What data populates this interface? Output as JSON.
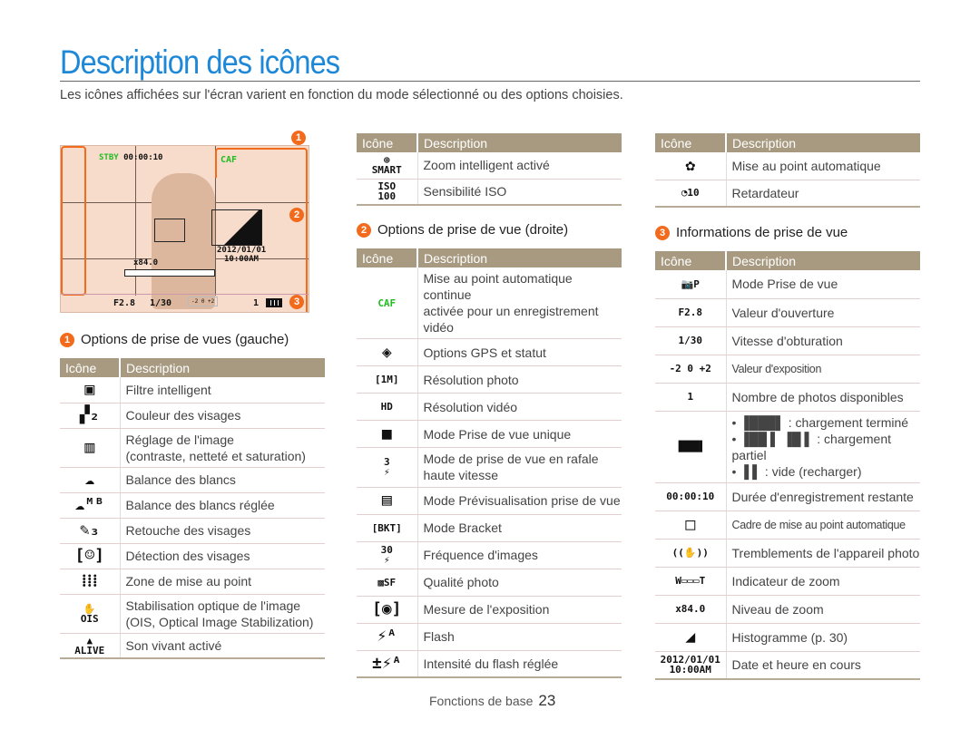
{
  "title": "Description des icônes",
  "intro": "Les icônes affichées sur l'écran varient en fonction du mode sélectionné ou des options choisies.",
  "header": {
    "icon": "Icône",
    "desc": "Description"
  },
  "colors": {
    "title": "#1e88d8",
    "table_header": "#a89a80",
    "badge": "#f26a1b",
    "caf": "#22bb22",
    "screen_bg": "#f8dccb"
  },
  "screen": {
    "stby": "STBY",
    "time": "00:00:10",
    "caf": "CAF",
    "zoom_level": "x84.0",
    "date": "2012/01/01",
    "clock": "10:00AM",
    "aperture": "F2.8",
    "shutter": "1/30",
    "shots": "1",
    "ev": "-2   0   +2",
    "badges": [
      "1",
      "2",
      "3"
    ]
  },
  "sections": [
    {
      "num": "1",
      "title": "Options de prise de vues (gauche)"
    },
    {
      "num": "2",
      "title": "Options de prise de vue (droite)"
    },
    {
      "num": "3",
      "title": "Informations de prise de vue"
    }
  ],
  "left_table": [
    {
      "icon": "smart-filter-icon",
      "glyph": "▣",
      "d": "Filtre intelligent"
    },
    {
      "icon": "face-tone-icon",
      "glyph": "▞₂",
      "d": "Couleur des visages"
    },
    {
      "icon": "image-adjust-icon",
      "glyph": "▥",
      "d": "Réglage de l'image\n(contraste, netteté et saturation)"
    },
    {
      "icon": "white-balance-icon",
      "glyph": "☁",
      "d": "Balance des blancs"
    },
    {
      "icon": "custom-white-balance-icon",
      "glyph": "☁ᴹᴮ",
      "d": "Balance des blancs réglée"
    },
    {
      "icon": "face-retouch-icon",
      "glyph": "✎₃",
      "d": "Retouche des visages"
    },
    {
      "icon": "face-detection-icon",
      "glyph": "[☺]",
      "d": "Détection des visages"
    },
    {
      "icon": "focus-area-icon",
      "glyph": "⁞⁞⁞",
      "d": "Zone de mise au point"
    },
    {
      "icon": "ois-icon",
      "glyph": "✋\nOIS",
      "d": "Stabilisation optique de l'image\n(OIS, Optical Image Stabilization)"
    },
    {
      "icon": "live-sound-icon",
      "glyph": "▲\nALIVE",
      "d": "Son vivant activé"
    }
  ],
  "mid_top_table": [
    {
      "icon": "smart-zoom-icon",
      "glyph": "⊕\nSMART",
      "d": "Zoom intelligent activé"
    },
    {
      "icon": "iso-icon",
      "glyph": "ISO\n100",
      "d": "Sensibilité ISO"
    }
  ],
  "mid_table": [
    {
      "icon": "caf-icon",
      "glyph": "CAF",
      "d": "Mise au point automatique continue\nactivée pour un enregistrement vidéo",
      "green": true
    },
    {
      "icon": "gps-icon",
      "glyph": "◈",
      "d": "Options GPS et statut"
    },
    {
      "icon": "photo-resolution-icon",
      "glyph": "[1M]",
      "d": "Résolution photo"
    },
    {
      "icon": "video-resolution-icon",
      "glyph": "HD",
      "d": "Résolution vidéo"
    },
    {
      "icon": "single-shot-icon",
      "glyph": "■",
      "d": "Mode Prise de vue unique"
    },
    {
      "icon": "burst-icon",
      "glyph": "3\n⚡",
      "d": "Mode de prise de vue en rafale\nhaute vitesse"
    },
    {
      "icon": "preview-icon",
      "glyph": "▤",
      "d": "Mode Prévisualisation prise de vue"
    },
    {
      "icon": "bracket-icon",
      "glyph": "[BKT]",
      "d": "Mode Bracket"
    },
    {
      "icon": "frame-rate-icon",
      "glyph": "30\n⚡",
      "d": "Fréquence d'images"
    },
    {
      "icon": "photo-quality-icon",
      "glyph": "▩SF",
      "d": "Qualité photo"
    },
    {
      "icon": "metering-icon",
      "glyph": "[◉]",
      "d": "Mesure de l'exposition"
    },
    {
      "icon": "flash-icon",
      "glyph": "⚡ᴬ",
      "d": "Flash"
    },
    {
      "icon": "flash-intensity-icon",
      "glyph": "±⚡ᴬ",
      "d": "Intensité du flash réglée"
    }
  ],
  "right_top_table": [
    {
      "icon": "macro-af-icon",
      "glyph": "✿",
      "d": "Mise au point automatique"
    },
    {
      "icon": "timer-icon",
      "glyph": "◔10",
      "d": "Retardateur"
    }
  ],
  "right_table": [
    {
      "icon": "shooting-mode-icon",
      "glyph": "📷P",
      "d": "Mode Prise de vue"
    },
    {
      "icon": "aperture-icon",
      "glyph": "F2.8",
      "d": "Valeur d'ouverture"
    },
    {
      "icon": "shutter-icon",
      "glyph": "1/30",
      "d": "Vitesse d'obturation"
    },
    {
      "icon": "exposure-icon",
      "glyph": "-2 0 +2",
      "d": "Valeur d'exposition",
      "small": true
    },
    {
      "icon": "shots-remaining-icon",
      "glyph": "1",
      "d": "Nombre de photos disponibles"
    },
    {
      "icon": "battery-icon",
      "glyph": "▐███▌",
      "battery": [
        "• ▐███▌ : chargement terminé",
        "• ▐██ ▌ ▐█  ▌ : chargement partiel",
        "• ▐   ▌ : vide (recharger)"
      ]
    },
    {
      "icon": "recording-time-icon",
      "glyph": "00:00:10",
      "d": "Durée d'enregistrement restante"
    },
    {
      "icon": "af-frame-icon",
      "glyph": "□",
      "d": "Cadre de mise au point automatique",
      "small": true
    },
    {
      "icon": "camera-shake-icon",
      "glyph": "((✋))",
      "d": "Tremblements de l'appareil photo"
    },
    {
      "icon": "zoom-bar-icon",
      "glyph": "W▭▭▭T",
      "d": "Indicateur de zoom"
    },
    {
      "icon": "zoom-level-icon",
      "glyph": "x84.0",
      "d": "Niveau de zoom"
    },
    {
      "icon": "histogram-icon",
      "glyph": "◢",
      "d": "Histogramme (p. 30)"
    },
    {
      "icon": "date-time-icon",
      "glyph": "2012/01/01\n10:00AM",
      "d": "Date et heure en cours"
    }
  ],
  "footer": {
    "label": "Fonctions de base",
    "page": "23"
  }
}
